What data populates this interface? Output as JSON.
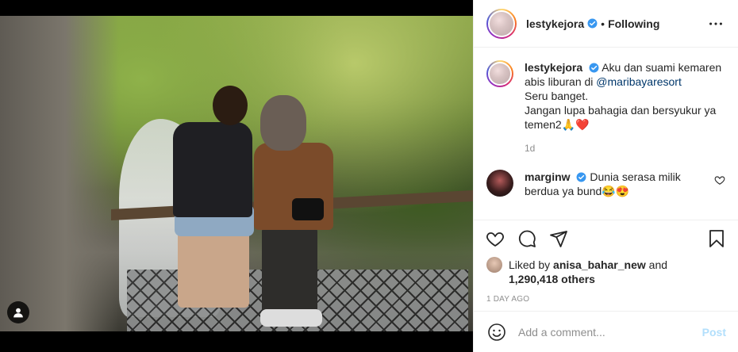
{
  "post": {
    "author": "lestykejora",
    "follow_status": "Following",
    "separator": "•",
    "more_icon": "more-horizontal-icon"
  },
  "caption": {
    "username": "lestykejora",
    "text_before": "Aku dan suami kemaren abis liburan di ",
    "mention": "@maribayaresort",
    "line2": "Seru banget.",
    "line3": "Jangan lupa bahagia dan bersyukur ya temen2🙏❤️",
    "time": "1d"
  },
  "comment": {
    "username": "marginw",
    "text": "Dunia serasa milik berdua ya bund😂😍"
  },
  "actions": {
    "like_icon": "heart-icon",
    "comment_icon": "comment-icon",
    "share_icon": "share-icon",
    "save_icon": "bookmark-icon"
  },
  "likes": {
    "prefix": "Liked by ",
    "user": "anisa_bahar_new",
    "suffix": " and",
    "count": "1,290,418 others"
  },
  "date": "1 DAY AGO",
  "add_comment": {
    "placeholder": "Add a comment...",
    "post_label": "Post"
  },
  "colors": {
    "link": "#00376b",
    "verified": "#3897f0",
    "post_disabled": "#b2dffc",
    "meta": "#8e8e8e"
  }
}
